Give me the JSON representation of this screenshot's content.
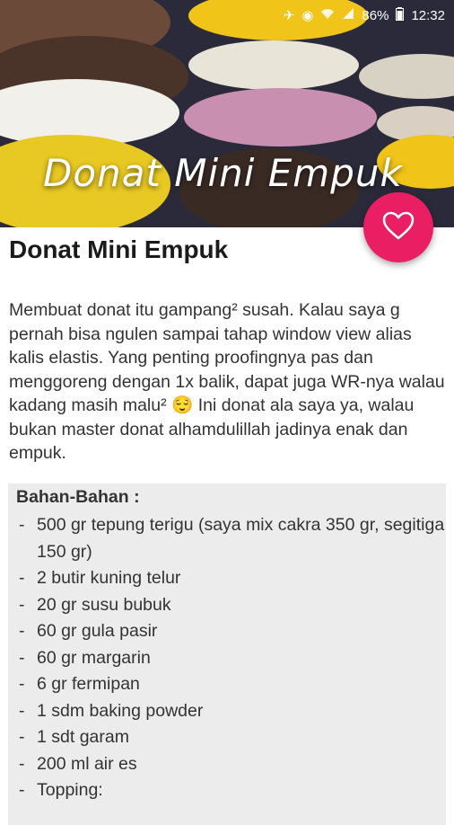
{
  "status_bar": {
    "battery": "86%",
    "time": "12:32"
  },
  "hero": {
    "title": "Donat Mini Empuk"
  },
  "recipe": {
    "title": "Donat Mini Empuk",
    "description": "Membuat donat itu gampang² susah. Kalau saya g pernah bisa ngulen sampai tahap window view alias kalis elastis. Yang penting proofingnya pas dan menggoreng dengan 1x balik, dapat juga WR-nya walau kadang masih malu² 😌 Ini donat ala saya ya, walau bukan master donat alhamdulillah jadinya enak dan empuk.",
    "ingredients_heading": "Bahan-Bahan :",
    "ingredients": [
      "500 gr tepung terigu (saya mix cakra 350 gr, segitiga 150 gr)",
      "2 butir kuning telur",
      "20 gr susu bubuk",
      "60 gr gula pasir",
      "60 gr margarin",
      "6 gr fermipan",
      "1 sdm baking powder",
      "1 sdt garam",
      "200 ml air es",
      "Topping:"
    ]
  },
  "colors": {
    "accent": "#e91e63",
    "panel": "#ececec"
  },
  "icons": {
    "favorite": "heart-outline-icon"
  }
}
